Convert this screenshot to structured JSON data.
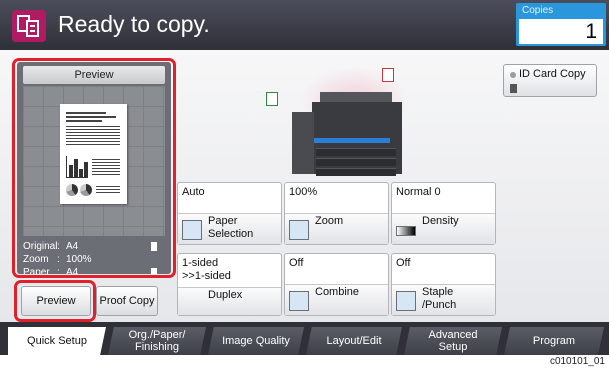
{
  "header": {
    "title": "Ready to copy.",
    "copies_label": "Copies",
    "copies_value": "1"
  },
  "preview": {
    "heading": "Preview",
    "original_key": "Original",
    "original_val": "A4",
    "zoom_key": "Zoom",
    "zoom_val": "100%",
    "paper_key": "Paper",
    "paper_val": "A4",
    "sep": ":"
  },
  "buttons": {
    "preview": "Preview",
    "proof_copy": "Proof Copy",
    "id_card_copy": "ID Card Copy"
  },
  "tiles": [
    {
      "value": "Auto",
      "label": "Paper\nSelection"
    },
    {
      "value": "100%",
      "label": "Zoom"
    },
    {
      "value": "Normal 0",
      "label": "Density"
    },
    {
      "value": "1-sided\n>>1-sided",
      "label": "Duplex"
    },
    {
      "value": "Off",
      "label": "Combine"
    },
    {
      "value": "Off",
      "label": "Staple\n/Punch"
    }
  ],
  "tabs": [
    {
      "label": "Quick Setup"
    },
    {
      "label": "Org./Paper/\nFinishing"
    },
    {
      "label": "Image Quality"
    },
    {
      "label": "Layout/Edit"
    },
    {
      "label": "Advanced\nSetup"
    },
    {
      "label": "Program"
    }
  ],
  "footer_code": "c010101_01",
  "colors": {
    "accent": "#2a96dc",
    "highlight": "#e0202a",
    "app_icon": "#b01c63"
  }
}
